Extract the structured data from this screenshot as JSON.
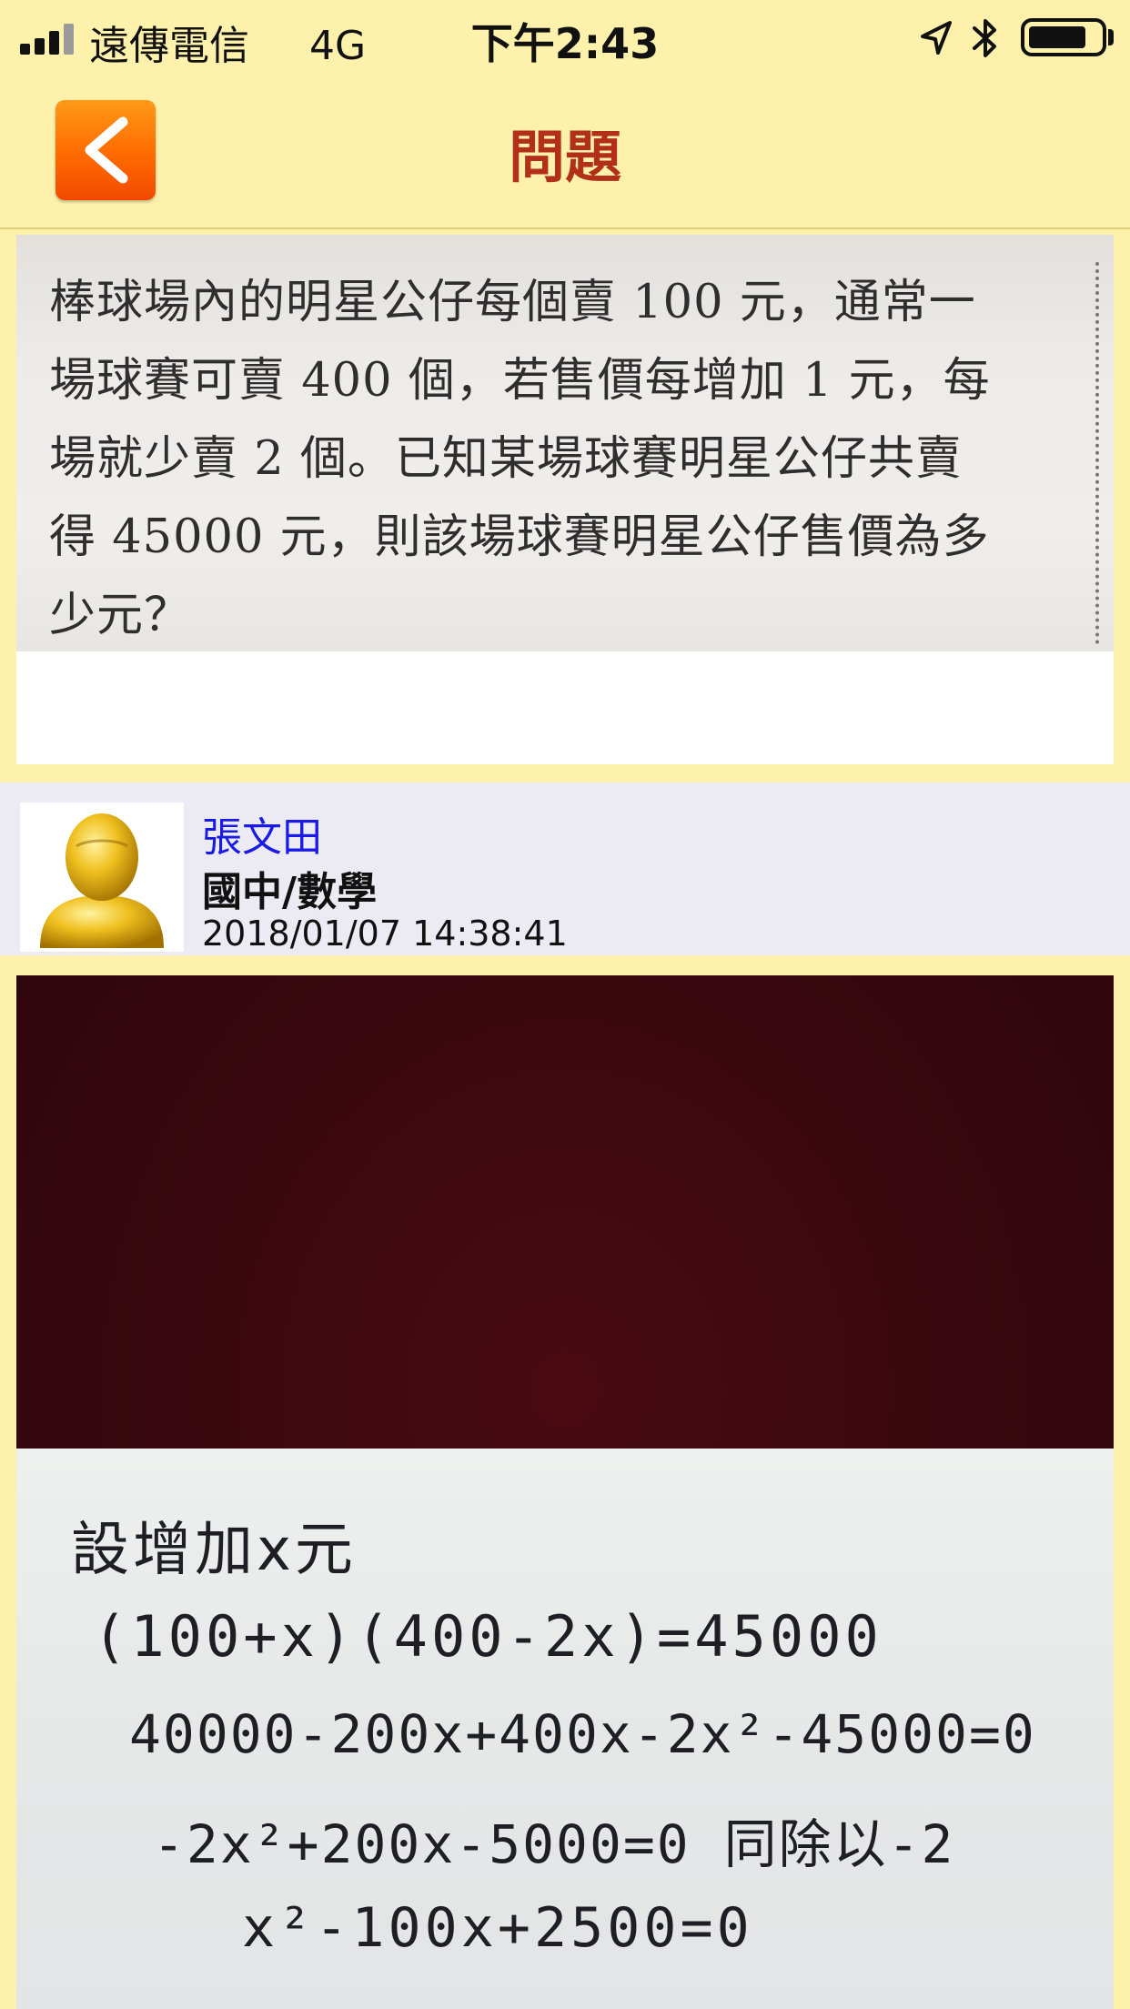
{
  "status_bar": {
    "carrier": "遠傳電信",
    "network": "4G",
    "time": "下午2:43",
    "icons": [
      "signal-icon",
      "location-arrow-icon",
      "bluetooth-icon",
      "battery-icon"
    ]
  },
  "nav": {
    "back_icon": "chevron-left-icon",
    "title": "問題"
  },
  "question": {
    "lines": [
      "棒球場內的明星公仔每個賣 100 元，通常一",
      "場球賽可賣 400 個，若售價每增加 1 元，每",
      "場就少賣 2 個。已知某場球賽明星公仔共賣",
      "得 45000 元，則該場球賽明星公仔售價為多",
      "少元？"
    ]
  },
  "author": {
    "avatar_icon": "user-avatar-icon",
    "name": "張文田",
    "category": "國中/數學",
    "timestamp": "2018/01/07 14:38:41"
  },
  "answer": {
    "handwritten_lines": [
      "設增加x元",
      "(100+x)(400-2x)=45000",
      "40000-200x+400x-2x²-45000=0",
      "-2x²+200x-5000=0 同除以-2",
      "x²-100x+2500=0"
    ]
  },
  "colors": {
    "background": "#fdf1ab",
    "title": "#b2301a",
    "back_button": "#ff6a00",
    "author_name": "#1a1ae6",
    "author_strip": "#ecebf3"
  }
}
